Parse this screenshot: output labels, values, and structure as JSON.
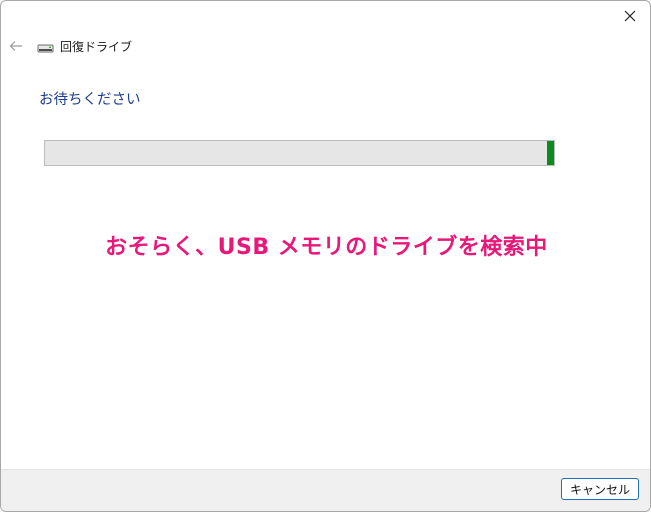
{
  "window": {
    "title": "回復ドライブ",
    "close_icon": "close-icon",
    "back_icon": "back-arrow-icon",
    "title_icon": "drive-icon"
  },
  "main": {
    "heading": "お待ちください",
    "progress": {
      "marquee_segment_start_fraction": 0.987,
      "marquee_segment_end_fraction": 1.0,
      "color": "#0b8a1e"
    }
  },
  "annotation": {
    "text": "おそらく、USB メモリのドライブを検索中",
    "color": "#e8177a"
  },
  "footer": {
    "cancel_label": "キャンセル"
  }
}
